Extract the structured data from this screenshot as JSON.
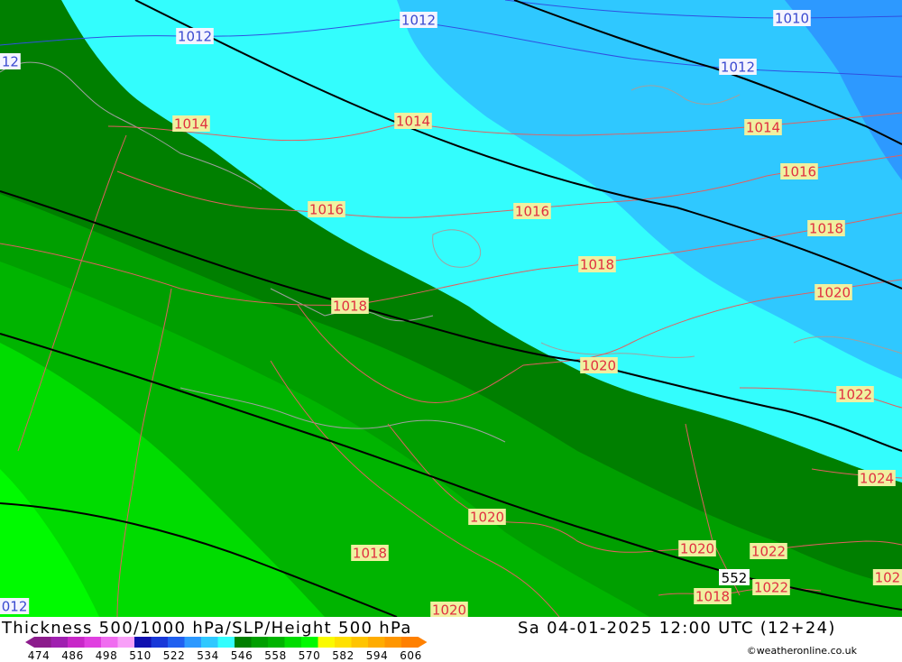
{
  "map": {
    "colors": {
      "thickness_546": "#007f00",
      "thickness_552": "#009f00",
      "thickness_558": "#00b400",
      "thickness_564": "#00dc00",
      "thickness_570": "#00fa00",
      "thickness_528": "#33fdfd",
      "thickness_522": "#2fc8ff",
      "thickness_516": "#2d99ff",
      "isobar": "#e06060",
      "isobar_low": "#3050e0",
      "height_contour": "#000000",
      "coastline": "#a0a0a0"
    },
    "isobar_labels": [
      {
        "text": "1012",
        "color": "#3a4ad0"
      },
      {
        "text": "1012",
        "color": "#3a4ad0"
      },
      {
        "text": "1012",
        "color": "#3a4ad0"
      },
      {
        "text": "12",
        "color": "#3a4ad0"
      },
      {
        "text": "1010",
        "color": "#3a4ad0"
      },
      {
        "text": "1014",
        "color": "#e03040"
      },
      {
        "text": "1014",
        "color": "#e03040"
      },
      {
        "text": "1014",
        "color": "#e03040"
      },
      {
        "text": "1016",
        "color": "#e03040"
      },
      {
        "text": "1016",
        "color": "#e03040"
      },
      {
        "text": "1016",
        "color": "#e03040"
      },
      {
        "text": "1018",
        "color": "#e03040"
      },
      {
        "text": "1018",
        "color": "#e03040"
      },
      {
        "text": "1018",
        "color": "#e03040"
      },
      {
        "text": "1018",
        "color": "#e03040"
      },
      {
        "text": "1018",
        "color": "#e03040"
      },
      {
        "text": "1020",
        "color": "#e03040"
      },
      {
        "text": "1020",
        "color": "#e03040"
      },
      {
        "text": "1020",
        "color": "#e03040"
      },
      {
        "text": "1020",
        "color": "#e03040"
      },
      {
        "text": "1020",
        "color": "#e03040"
      },
      {
        "text": "1022",
        "color": "#e03040"
      },
      {
        "text": "1022",
        "color": "#e03040"
      },
      {
        "text": "1022",
        "color": "#e03040"
      },
      {
        "text": "1024",
        "color": "#e03040"
      },
      {
        "text": "102",
        "color": "#e03040"
      },
      {
        "text": "012",
        "color": "#3a4ad0"
      }
    ],
    "height_label": "552"
  },
  "footer": {
    "title": "Thickness 500/1000 hPa/SLP/Height 500 hPa",
    "datetime": "Sa 04-01-2025 12:00 UTC (12+24)",
    "credit": "©weatheronline.co.uk",
    "legend_ticks": [
      "474",
      "486",
      "498",
      "510",
      "522",
      "534",
      "546",
      "558",
      "570",
      "582",
      "594",
      "606"
    ],
    "legend_colors": [
      "#8c1c8c",
      "#a020b0",
      "#c828c8",
      "#e040e0",
      "#f06cf0",
      "#f8a0f8",
      "#1010b0",
      "#1838d8",
      "#2060f0",
      "#2d99ff",
      "#2fc8ff",
      "#33fdfd",
      "#007f00",
      "#009f00",
      "#00b400",
      "#00dc00",
      "#00fa00",
      "#fafa00",
      "#ffe000",
      "#ffc400",
      "#ffac00",
      "#ff9600",
      "#ff8000"
    ]
  }
}
